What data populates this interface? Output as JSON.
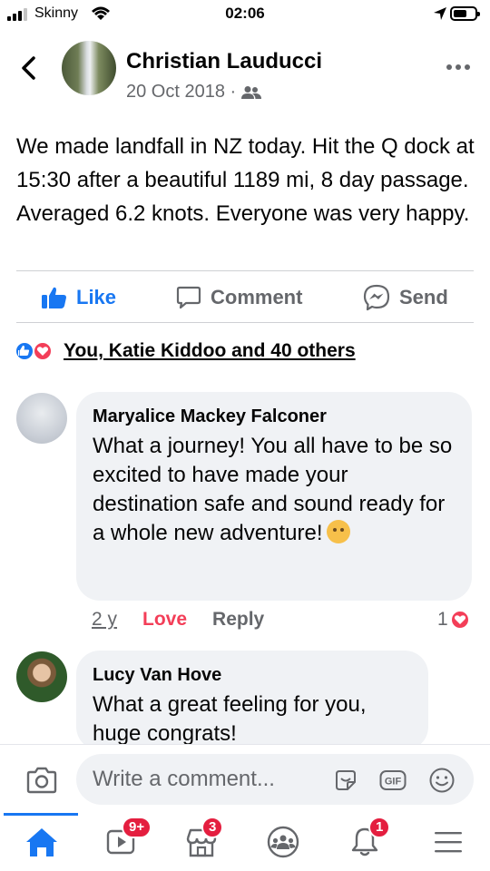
{
  "status_bar": {
    "carrier": "Skinny",
    "time": "02:06"
  },
  "post": {
    "author": "Christian Lauducci",
    "date": "20 Oct 2018 ·",
    "text": "We made landfall in NZ today. Hit the Q dock at 15:30 after a beautiful 1189 mi, 8 day passage. Averaged 6.2 knots. Everyone was very happy.",
    "actions": {
      "like": "Like",
      "comment": "Comment",
      "send": "Send"
    },
    "reactions_text": "You, Katie Kiddoo and 40 others"
  },
  "comments": [
    {
      "author": "Maryalice Mackey Falconer",
      "text": "What a journey! You all have to be so excited to have made your destination safe and sound ready for a whole new adventure!",
      "time": "2 y",
      "reaction_label": "Love",
      "reply_label": "Reply",
      "reaction_count": "1"
    },
    {
      "author": "Lucy Van Hove",
      "text": "What a great feeling for you, huge congrats!"
    }
  ],
  "composer": {
    "placeholder": "Write a comment..."
  },
  "tabbar": {
    "badges": {
      "watch": "9+",
      "marketplace": "3",
      "notifications": "1"
    }
  },
  "colors": {
    "accent": "#1877f2",
    "love": "#f33e58",
    "badge": "#e41e3f"
  }
}
